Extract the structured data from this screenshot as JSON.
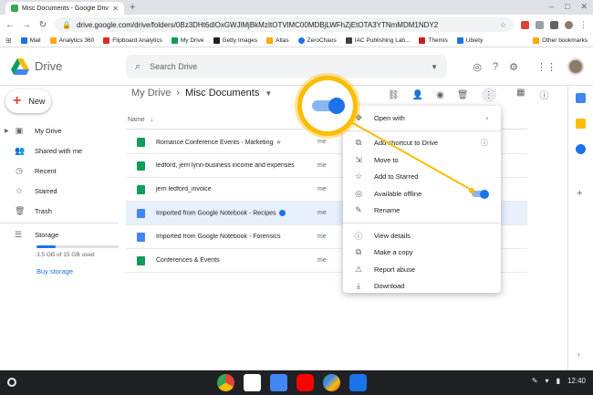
{
  "browser": {
    "tab_title": "Misc Documents - Google Drive",
    "url": "drive.google.com/drive/folders/0Bz3DHt6dlOxGWJlMjBkMzItOTVlMC00MDBjLWFhZjEtOTA3YTNmMDM1NDY2"
  },
  "bookmarks": [
    "Mail",
    "Analytics 360",
    "Flipboard Analytics",
    "My Drive",
    "Getty Images",
    "Atlas",
    "ZeroChaos",
    "IAC Publishing Lab...",
    "Themis",
    "Ubiety"
  ],
  "bookmarks_other": "Other bookmarks",
  "drive": {
    "logo_text": "Drive",
    "search_placeholder": "Search Drive"
  },
  "sidebar": {
    "new_label": "New",
    "items": [
      {
        "label": "My Drive",
        "icon": "my-drive-icon"
      },
      {
        "label": "Shared with me",
        "icon": "shared-icon"
      },
      {
        "label": "Recent",
        "icon": "clock-icon"
      },
      {
        "label": "Starred",
        "icon": "star-icon"
      },
      {
        "label": "Trash",
        "icon": "trash-icon"
      }
    ],
    "storage_label": "Storage",
    "storage_used": "3.5 GB of 15 GB used",
    "storage_fraction": 0.23,
    "buy_storage": "Buy storage"
  },
  "breadcrumb": {
    "parent": "My Drive",
    "current": "Misc Documents"
  },
  "list": {
    "name_header": "Name",
    "rows": [
      {
        "name": "Romance Conference Events - Marketing",
        "owner": "me",
        "type": "sheet",
        "starred": true
      },
      {
        "name": "ledford, jerri lynn-business income and expenses",
        "owner": "me",
        "type": "sheet"
      },
      {
        "name": "jerri ledford_invoice",
        "owner": "me",
        "type": "sheet"
      },
      {
        "name": "Imported from Google Notebook - Recipes",
        "owner": "me",
        "type": "doc",
        "selected": true,
        "shared": true
      },
      {
        "name": "Imported from Google Notebook - Forensics",
        "owner": "me",
        "type": "doc"
      },
      {
        "name": "Conferences & Events",
        "owner": "me",
        "type": "sheet"
      }
    ]
  },
  "menu": {
    "items": [
      {
        "label": "Open with",
        "icon": "open-with-icon",
        "submenu": true
      },
      {
        "sep": true
      },
      {
        "label": "Add shortcut to Drive",
        "icon": "add-shortcut-icon",
        "help": true
      },
      {
        "label": "Move to",
        "icon": "move-to-icon"
      },
      {
        "label": "Add to Starred",
        "icon": "star-icon"
      },
      {
        "label": "Available offline",
        "icon": "offline-icon",
        "toggle": true
      },
      {
        "label": "Rename",
        "icon": "rename-icon"
      },
      {
        "sep": true
      },
      {
        "label": "View details",
        "icon": "info-icon"
      },
      {
        "label": "Make a copy",
        "icon": "copy-icon"
      },
      {
        "label": "Report abuse",
        "icon": "report-icon"
      },
      {
        "label": "Download",
        "icon": "download-icon"
      }
    ]
  },
  "taskbar": {
    "time": "12:40"
  },
  "colors": {
    "accent": "#1a73e8",
    "callout": "#fbbc04",
    "selected_row": "#e8f0fe",
    "sheet": "#0f9d58",
    "doc": "#4285f4"
  }
}
